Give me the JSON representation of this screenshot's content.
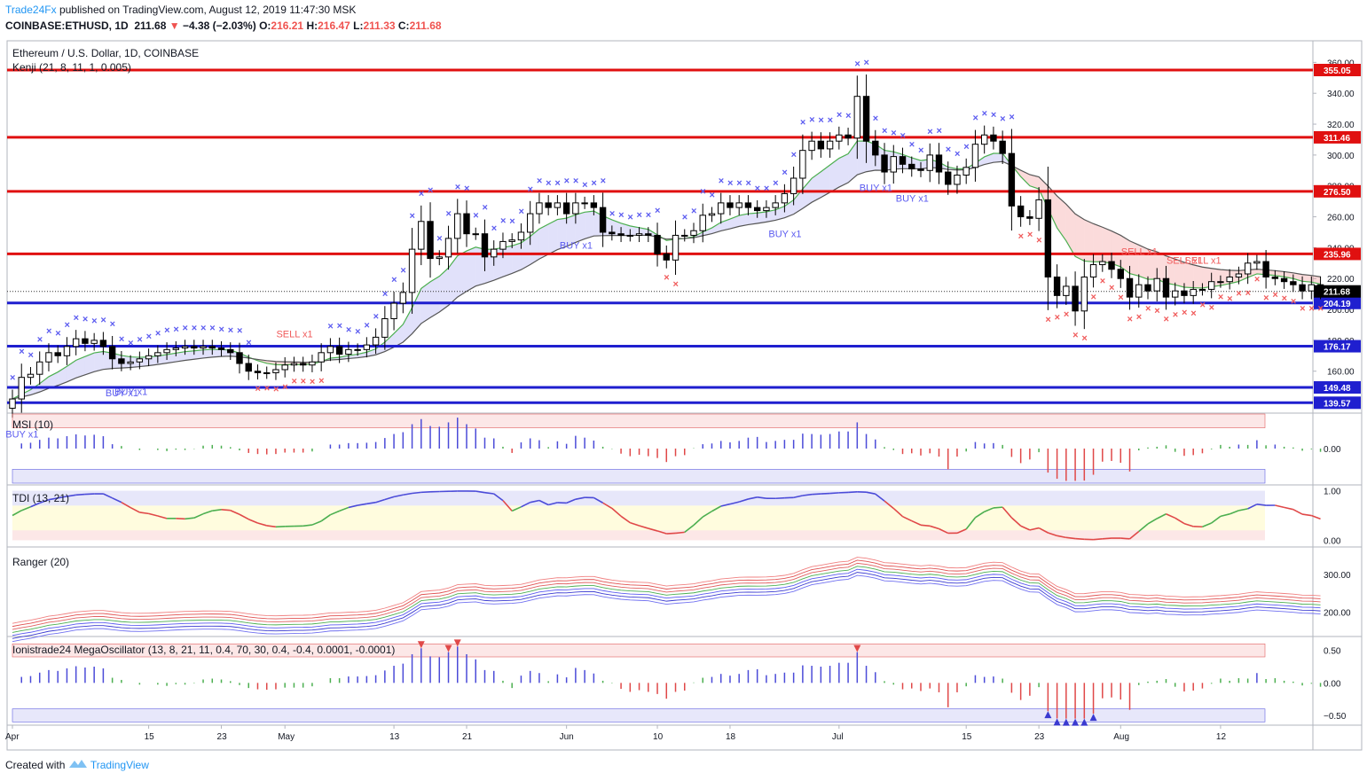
{
  "header": {
    "brand": "Trade24Fx",
    "published": "published on TradingView.com, August 12, 2019 11:47:30 MSK",
    "symbol": "COINBASE:ETHUSD, 1D",
    "last": "211.68",
    "change_arrow": "down-triangle-icon",
    "change": "−4.38 (−2.03%)",
    "o_label": "O:",
    "o": "216.21",
    "h_label": "H:",
    "h": "216.47",
    "l_label": "L:",
    "l": "211.33",
    "c_label": "C:",
    "c": "211.68"
  },
  "footer": {
    "created_with": "Created with",
    "brand": "TradingView",
    "logo_icon": "tradingview-logo-icon"
  },
  "colors": {
    "up": "#ffffff",
    "down": "#000000",
    "support": "#1f1fcf",
    "resistance": "#e01010",
    "accent": "#2196f3",
    "buy": "#5b5bf0",
    "sell": "#f05b5b"
  },
  "chart_data": [
    {
      "type": "candlestick",
      "pane": "price",
      "title": "Ethereum / U.S. Dollar, 1D, COINBASE",
      "indicator_label": "Kenji (21, 8, 11, 1, 0.005)",
      "ylim": [
        134,
        374
      ],
      "yticks": [
        160,
        180,
        200,
        220,
        240,
        260,
        280,
        300,
        320,
        340,
        360
      ],
      "ytick_labels": [
        "160.00",
        "180.00",
        "200.00",
        "220.00",
        "240.00",
        "260.00",
        "280.00",
        "300.00",
        "320.00",
        "340.00",
        "360.00"
      ],
      "horizontal_levels": [
        {
          "value": 355.05,
          "label": "355.05",
          "color": "#e01010"
        },
        {
          "value": 311.46,
          "label": "311.46",
          "color": "#e01010"
        },
        {
          "value": 276.5,
          "label": "276.50",
          "color": "#e01010"
        },
        {
          "value": 235.96,
          "label": "235.96",
          "color": "#e01010"
        },
        {
          "value": 204.19,
          "label": "204.19",
          "color": "#1f1fcf"
        },
        {
          "value": 176.17,
          "label": "176.17",
          "color": "#1f1fcf"
        },
        {
          "value": 149.48,
          "label": "149.48",
          "color": "#1f1fcf"
        },
        {
          "value": 139.57,
          "label": "139.57",
          "color": "#1f1fcf"
        }
      ],
      "last_price": {
        "value": 211.68,
        "label": "211.68"
      },
      "x_ticks": [
        "Apr",
        "15",
        "23",
        "May",
        "13",
        "21",
        "Jun",
        "10",
        "18",
        "Jul",
        "15",
        "23",
        "Aug",
        "12"
      ],
      "x_tick_days": [
        0,
        15,
        23,
        30,
        42,
        50,
        61,
        71,
        79,
        91,
        105,
        113,
        122,
        133
      ],
      "close": [
        142,
        156,
        158,
        166,
        172,
        170,
        176,
        181,
        178,
        180,
        176,
        168,
        165,
        166,
        168,
        170,
        172,
        174,
        175,
        176,
        175,
        176,
        175,
        174,
        172,
        165,
        160,
        159,
        159,
        161,
        164,
        165,
        164,
        166,
        172,
        176,
        171,
        174,
        174,
        177,
        182,
        194,
        204,
        211,
        239,
        257,
        233,
        234,
        246,
        262,
        249,
        249,
        234,
        239,
        244,
        245,
        250,
        262,
        269,
        266,
        269,
        262,
        269,
        269,
        266,
        250,
        249,
        248,
        248,
        249,
        248,
        236,
        232,
        248,
        248,
        251,
        261,
        262,
        269,
        266,
        269,
        266,
        264,
        266,
        269,
        275,
        285,
        303,
        309,
        304,
        309,
        313,
        311,
        338,
        309,
        300,
        289,
        299,
        294,
        291,
        290,
        300,
        289,
        281,
        287,
        292,
        307,
        313,
        309,
        301,
        267,
        260,
        259,
        271,
        221,
        209,
        215,
        199,
        221,
        229,
        231,
        226,
        220,
        208,
        216,
        212,
        220,
        208,
        212,
        209,
        213,
        213,
        218,
        218,
        221,
        223,
        230,
        231,
        221,
        220,
        218,
        216,
        212,
        216,
        212
      ]
    },
    {
      "type": "histogram",
      "pane": "msi",
      "label": "MSI (10)",
      "ylim": [
        -0.75,
        0.75
      ],
      "yticks": [
        0
      ],
      "ytick_labels": [
        "0.00"
      ],
      "bands": [
        [
          0.45,
          0.75
        ],
        [
          -0.75,
          -0.45
        ]
      ]
    },
    {
      "type": "line",
      "pane": "tdi",
      "label": "TDI (13, 21)",
      "ylim": [
        -0.1,
        1.1
      ],
      "yticks": [
        0,
        1
      ],
      "ytick_labels": [
        "0.00",
        "1.00"
      ],
      "bands": [
        [
          0.7,
          1.0
        ],
        [
          0.0,
          0.2
        ]
      ]
    },
    {
      "type": "line",
      "pane": "ranger",
      "label": "Ranger (20)",
      "ylim": [
        140,
        370
      ],
      "yticks": [
        200,
        300
      ],
      "ytick_labels": [
        "200.00",
        "300.00"
      ]
    },
    {
      "type": "histogram",
      "pane": "mega",
      "label": "Ionistrade24 MegaOscillator (13, 8, 21, 11, 0.4, 70, 30, 0.4, -0.4, 0.0001, -0.0001)",
      "ylim": [
        -0.65,
        0.7
      ],
      "yticks": [
        -0.5,
        0,
        0.5
      ],
      "ytick_labels": [
        "−0.50",
        "0.00",
        "0.50"
      ],
      "bands": [
        [
          0.4,
          0.6
        ],
        [
          -0.6,
          -0.4
        ]
      ]
    }
  ],
  "annotations": {
    "buy_labels": [
      {
        "text": "BUY x1",
        "day": 1
      },
      {
        "text": "BUY x1",
        "day": 12
      },
      {
        "text": "BUY x1",
        "day": 13
      },
      {
        "text": "BUY x1",
        "day": 62
      },
      {
        "text": "BUY x1",
        "day": 85
      },
      {
        "text": "BUY x1",
        "day": 95
      },
      {
        "text": "BUY x1",
        "day": 99
      }
    ],
    "sell_labels": [
      {
        "text": "SELL x1",
        "day": 31
      },
      {
        "text": "SELL x1",
        "day": 124
      },
      {
        "text": "SELL x1",
        "day": 129
      },
      {
        "text": "SELL x1",
        "day": 131
      }
    ]
  }
}
